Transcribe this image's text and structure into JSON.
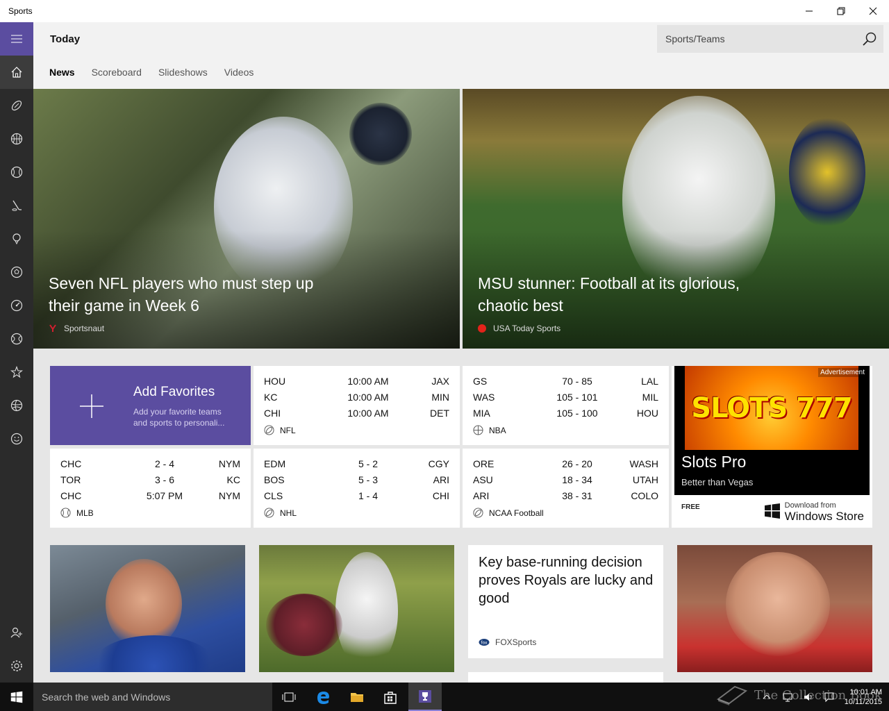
{
  "window": {
    "title": "Sports"
  },
  "header": {
    "page_title": "Today",
    "search_placeholder": "Sports/Teams",
    "tabs": [
      {
        "label": "News",
        "active": true
      },
      {
        "label": "Scoreboard",
        "active": false
      },
      {
        "label": "Slideshows",
        "active": false
      },
      {
        "label": "Videos",
        "active": false
      }
    ]
  },
  "nav": {
    "items": [
      "menu-icon",
      "home-icon",
      "football-icon",
      "basketball-icon",
      "baseball-icon",
      "hockey-icon",
      "golf-icon",
      "soccer-icon",
      "racing-icon",
      "tennis-icon",
      "favorites-icon",
      "volleyball-icon",
      "emoji-icon",
      "add-account-icon",
      "settings-icon"
    ]
  },
  "hero": [
    {
      "headline": "Seven NFL players who must step up their game in Week 6",
      "source": "Sportsnaut"
    },
    {
      "headline": "MSU stunner: Football at its glorious, chaotic best",
      "source": "USA Today Sports"
    }
  ],
  "favorites": {
    "title": "Add Favorites",
    "desc": "Add your favorite teams and sports to personali..."
  },
  "scores": {
    "nfl": {
      "league": "NFL",
      "rows": [
        {
          "t1": "HOU",
          "mid": "10:00 AM",
          "t2": "JAX"
        },
        {
          "t1": "KC",
          "mid": "10:00 AM",
          "t2": "MIN"
        },
        {
          "t1": "CHI",
          "mid": "10:00 AM",
          "t2": "DET"
        }
      ]
    },
    "nba": {
      "league": "NBA",
      "rows": [
        {
          "t1": "GS",
          "mid": "70  -  85",
          "t2": "LAL"
        },
        {
          "t1": "WAS",
          "mid": "105  -  101",
          "t2": "MIL"
        },
        {
          "t1": "MIA",
          "mid": "105  -  100",
          "t2": "HOU"
        }
      ]
    },
    "mlb": {
      "league": "MLB",
      "rows": [
        {
          "t1": "CHC",
          "mid": "2  -  4",
          "t2": "NYM"
        },
        {
          "t1": "TOR",
          "mid": "3  -  6",
          "t2": "KC"
        },
        {
          "t1": "CHC",
          "mid": "5:07 PM",
          "t2": "NYM"
        }
      ]
    },
    "nhl": {
      "league": "NHL",
      "rows": [
        {
          "t1": "EDM",
          "mid": "5  -  2",
          "t2": "CGY"
        },
        {
          "t1": "BOS",
          "mid": "5  -  3",
          "t2": "ARI"
        },
        {
          "t1": "CLS",
          "mid": "1  -  4",
          "t2": "CHI"
        }
      ]
    },
    "ncaa": {
      "league": "NCAA Football",
      "rows": [
        {
          "t1": "ORE",
          "mid": "26  -  20",
          "t2": "WASH"
        },
        {
          "t1": "ASU",
          "mid": "18  -  34",
          "t2": "UTAH"
        },
        {
          "t1": "ARI",
          "mid": "38  -  31",
          "t2": "COLO"
        }
      ]
    }
  },
  "ad": {
    "label": "Advertisement",
    "art_text": "SLOTS 777",
    "name": "Slots Pro",
    "tagline": "Better than Vegas",
    "price": "FREE",
    "store_small": "Download from",
    "store_big": "Windows Store"
  },
  "articles": {
    "text_tile": {
      "headline": "Key base-running decision proves Royals are lucky and good",
      "source": "FOXSports"
    }
  },
  "taskbar": {
    "search_placeholder": "Search the web and Windows",
    "time": "10:01 AM",
    "date": "10/11/2015"
  },
  "watermark": {
    "text": "The Collection Book"
  },
  "colors": {
    "accent": "#5b4da0",
    "nav_bg": "#2b2b2b",
    "taskbar_bg": "#101010"
  }
}
